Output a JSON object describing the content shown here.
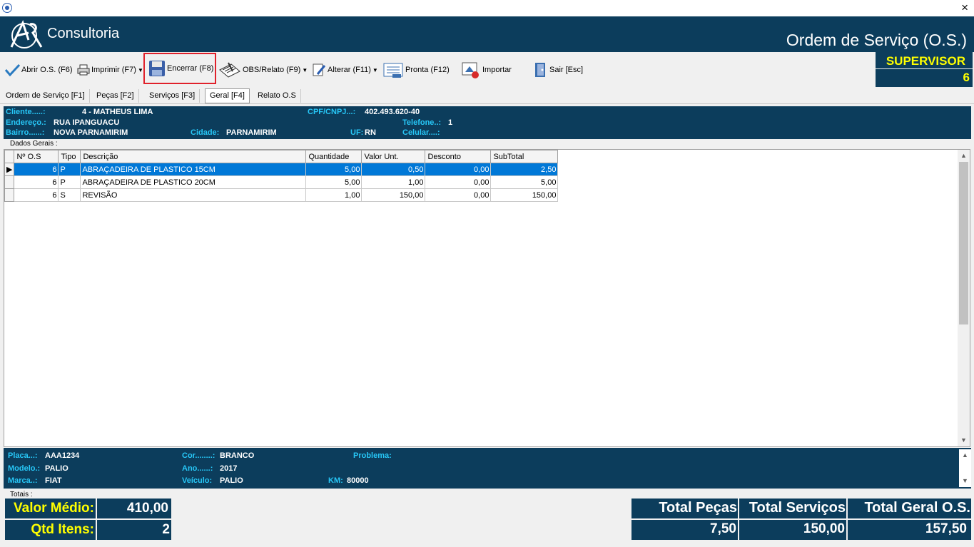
{
  "window": {
    "company": "Consultoria",
    "title": "Ordem de Serviço (O.S.)",
    "close": "×"
  },
  "toolbar": {
    "abrir": "Abrir O.S. (F6)",
    "imprimir": "Imprimir  (F7)",
    "encerrar": "Encerrar (F8)",
    "obs": "OBS/Relato (F9)",
    "alterar": "Alterar (F11)",
    "pronta": "Pronta (F12)",
    "importar": "Importar",
    "sair": "Sair [Esc]"
  },
  "user": {
    "role": "SUPERVISOR",
    "number": "6"
  },
  "tabs": [
    "Ordem de Serviço [F1]",
    "Peças [F2]",
    "Serviços [F3]",
    "Geral [F4]",
    "Relato O.S"
  ],
  "client": {
    "cliente_label": "Cliente.....:",
    "cliente": "4 - MATHEUS LIMA",
    "cpf_label": "CPF/CNPJ...:",
    "cpf": "402.493.620-40",
    "endereco_label": "Endereço.:",
    "endereco": "RUA IPANGUACU",
    "telefone_label": "Telefone..:",
    "telefone": "1",
    "bairro_label": "Bairro......:",
    "bairro": "NOVA PARNAMIRIM",
    "cidade_label": "Cidade:",
    "cidade": "PARNAMIRIM",
    "uf_label": "UF:",
    "uf": "RN",
    "celular_label": "Celular....:"
  },
  "grid": {
    "legend": "Dados Gerais :",
    "columns": [
      "Nº O.S",
      "Tipo",
      "Descrição",
      "Quantidade",
      "Valor Unt.",
      "Desconto",
      "SubTotal"
    ],
    "rows": [
      [
        "6",
        "P",
        "ABRAÇADEIRA DE PLASTICO 15CM",
        "5,00",
        "0,50",
        "0,00",
        "2,50"
      ],
      [
        "6",
        "P",
        "ABRAÇADEIRA DE PLASTICO 20CM",
        "5,00",
        "1,00",
        "0,00",
        "5,00"
      ],
      [
        "6",
        "S",
        "REVISÃO",
        "1,00",
        "150,00",
        "0,00",
        "150,00"
      ]
    ]
  },
  "vehicle": {
    "placa_label": "Placa...:",
    "placa": "AAA1234",
    "cor_label": "Cor........:",
    "cor": "BRANCO",
    "problema_label": "Problema:",
    "modelo_label": "Modelo.:",
    "modelo": "PALIO",
    "ano_label": "Ano......:",
    "ano": "2017",
    "marca_label": "Marca..:",
    "marca": "FIAT",
    "veiculo_label": "Veículo:",
    "veiculo": "PALIO",
    "km_label": "KM:",
    "km": "80000"
  },
  "totals": {
    "legend": "Totais :",
    "valor_medio_label": "Valor Médio:",
    "valor_medio": "410,00",
    "qtd_itens_label": "Qtd Itens:",
    "qtd_itens": "2",
    "pecas_label": "Total Peças",
    "pecas": "7,50",
    "servicos_label": "Total Serviços",
    "servicos": "150,00",
    "geral_label": "Total Geral O.S.",
    "geral": "157,50"
  }
}
